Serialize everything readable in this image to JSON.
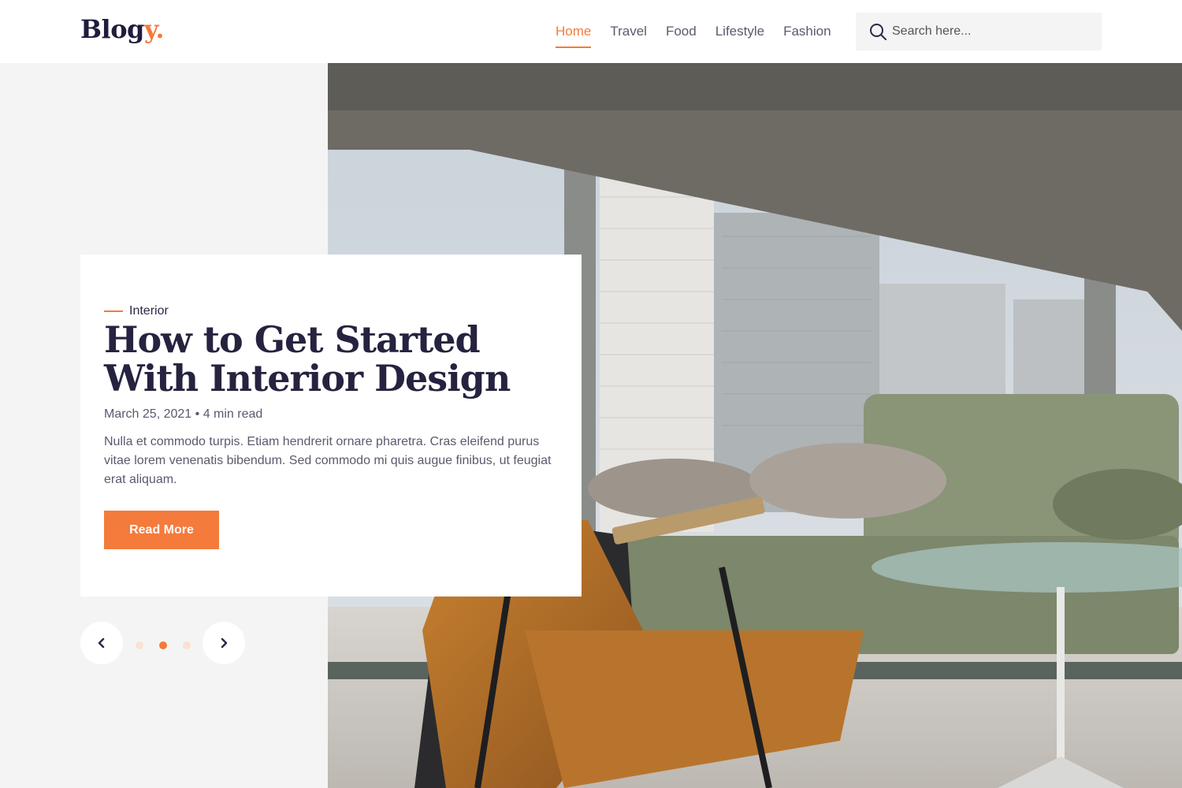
{
  "header": {
    "logo_text": "Blog",
    "logo_accent": "y.",
    "nav": [
      {
        "label": "Home",
        "active": true
      },
      {
        "label": "Travel",
        "active": false
      },
      {
        "label": "Food",
        "active": false
      },
      {
        "label": "Lifestyle",
        "active": false
      },
      {
        "label": "Fashion",
        "active": false
      }
    ],
    "search": {
      "placeholder": "Search here...",
      "icon": "search-icon"
    }
  },
  "hero": {
    "category": "Interior",
    "title": "How to Get Started With Interior Design",
    "date": "March 25, 2021",
    "read_time": "4 min read",
    "excerpt": "Nulla et commodo turpis. Etiam hendrerit ornare pharetra. Cras eleifend purus vitae lorem venenatis bibendum. Sed commodo mi quis augue finibus, ut feugiat erat aliquam.",
    "button_label": "Read More",
    "image": "interior-photo"
  },
  "slider": {
    "total_slides": 3,
    "active_index": 1,
    "prev_icon": "chevron-left-icon",
    "next_icon": "chevron-right-icon"
  },
  "colors": {
    "accent": "#f47b3c",
    "dark": "#25233f",
    "muted": "#5a5a6e",
    "panel": "#f4f4f4"
  }
}
